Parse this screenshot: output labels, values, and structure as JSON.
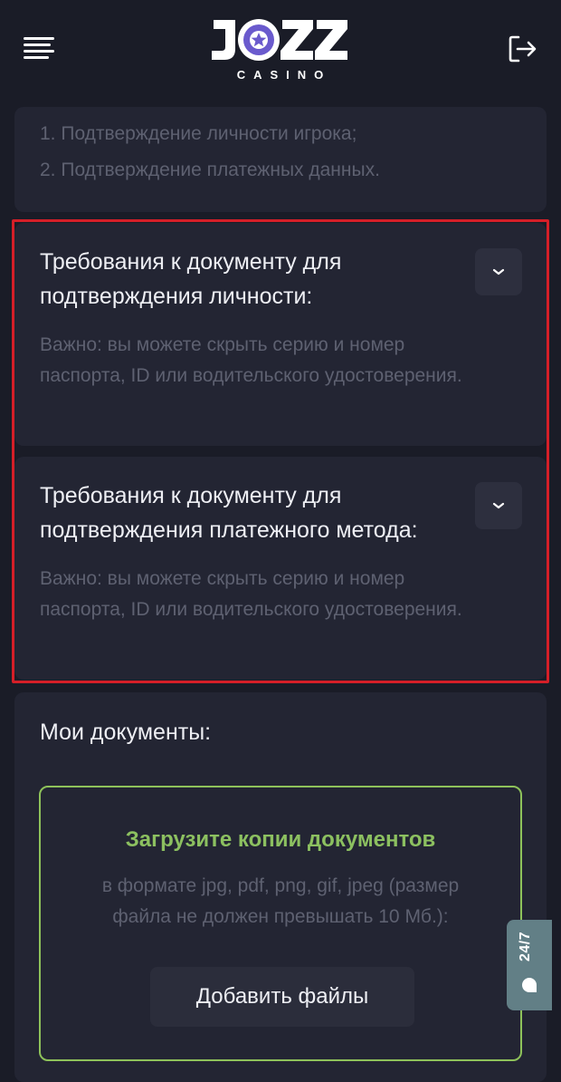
{
  "header": {
    "logo_wordmark": "JOZZ",
    "logo_subtitle": "CASINO"
  },
  "verification_steps": [
    "1. Подтверждение личности игрока;",
    "2. Подтверждение платежных данных."
  ],
  "requirements": [
    {
      "title": "Требования к документу для подтверждения личности:",
      "note": "Важно: вы можете скрыть серию и номер паспорта, ID или водительского удостоверения."
    },
    {
      "title": "Требования к документу для подтверждения платежного метода:",
      "note": "Важно: вы можете скрыть серию и номер паспорта, ID или водительского удостоверения."
    }
  ],
  "documents": {
    "title": "Мои документы:",
    "upload_title": "Загрузите копии документов",
    "upload_note": "в формате jpg, pdf, png, gif, jpeg (размер файла не должен превышать 10 Мб.):",
    "add_button": "Добавить файлы"
  },
  "support_tab": {
    "label": "24/7"
  },
  "colors": {
    "background": "#1a1c27",
    "card": "#232533",
    "accent_green": "#8cc060",
    "highlight_red": "#d51f28",
    "support_tab": "#627f86",
    "logo_purple": "#6a5acd"
  }
}
